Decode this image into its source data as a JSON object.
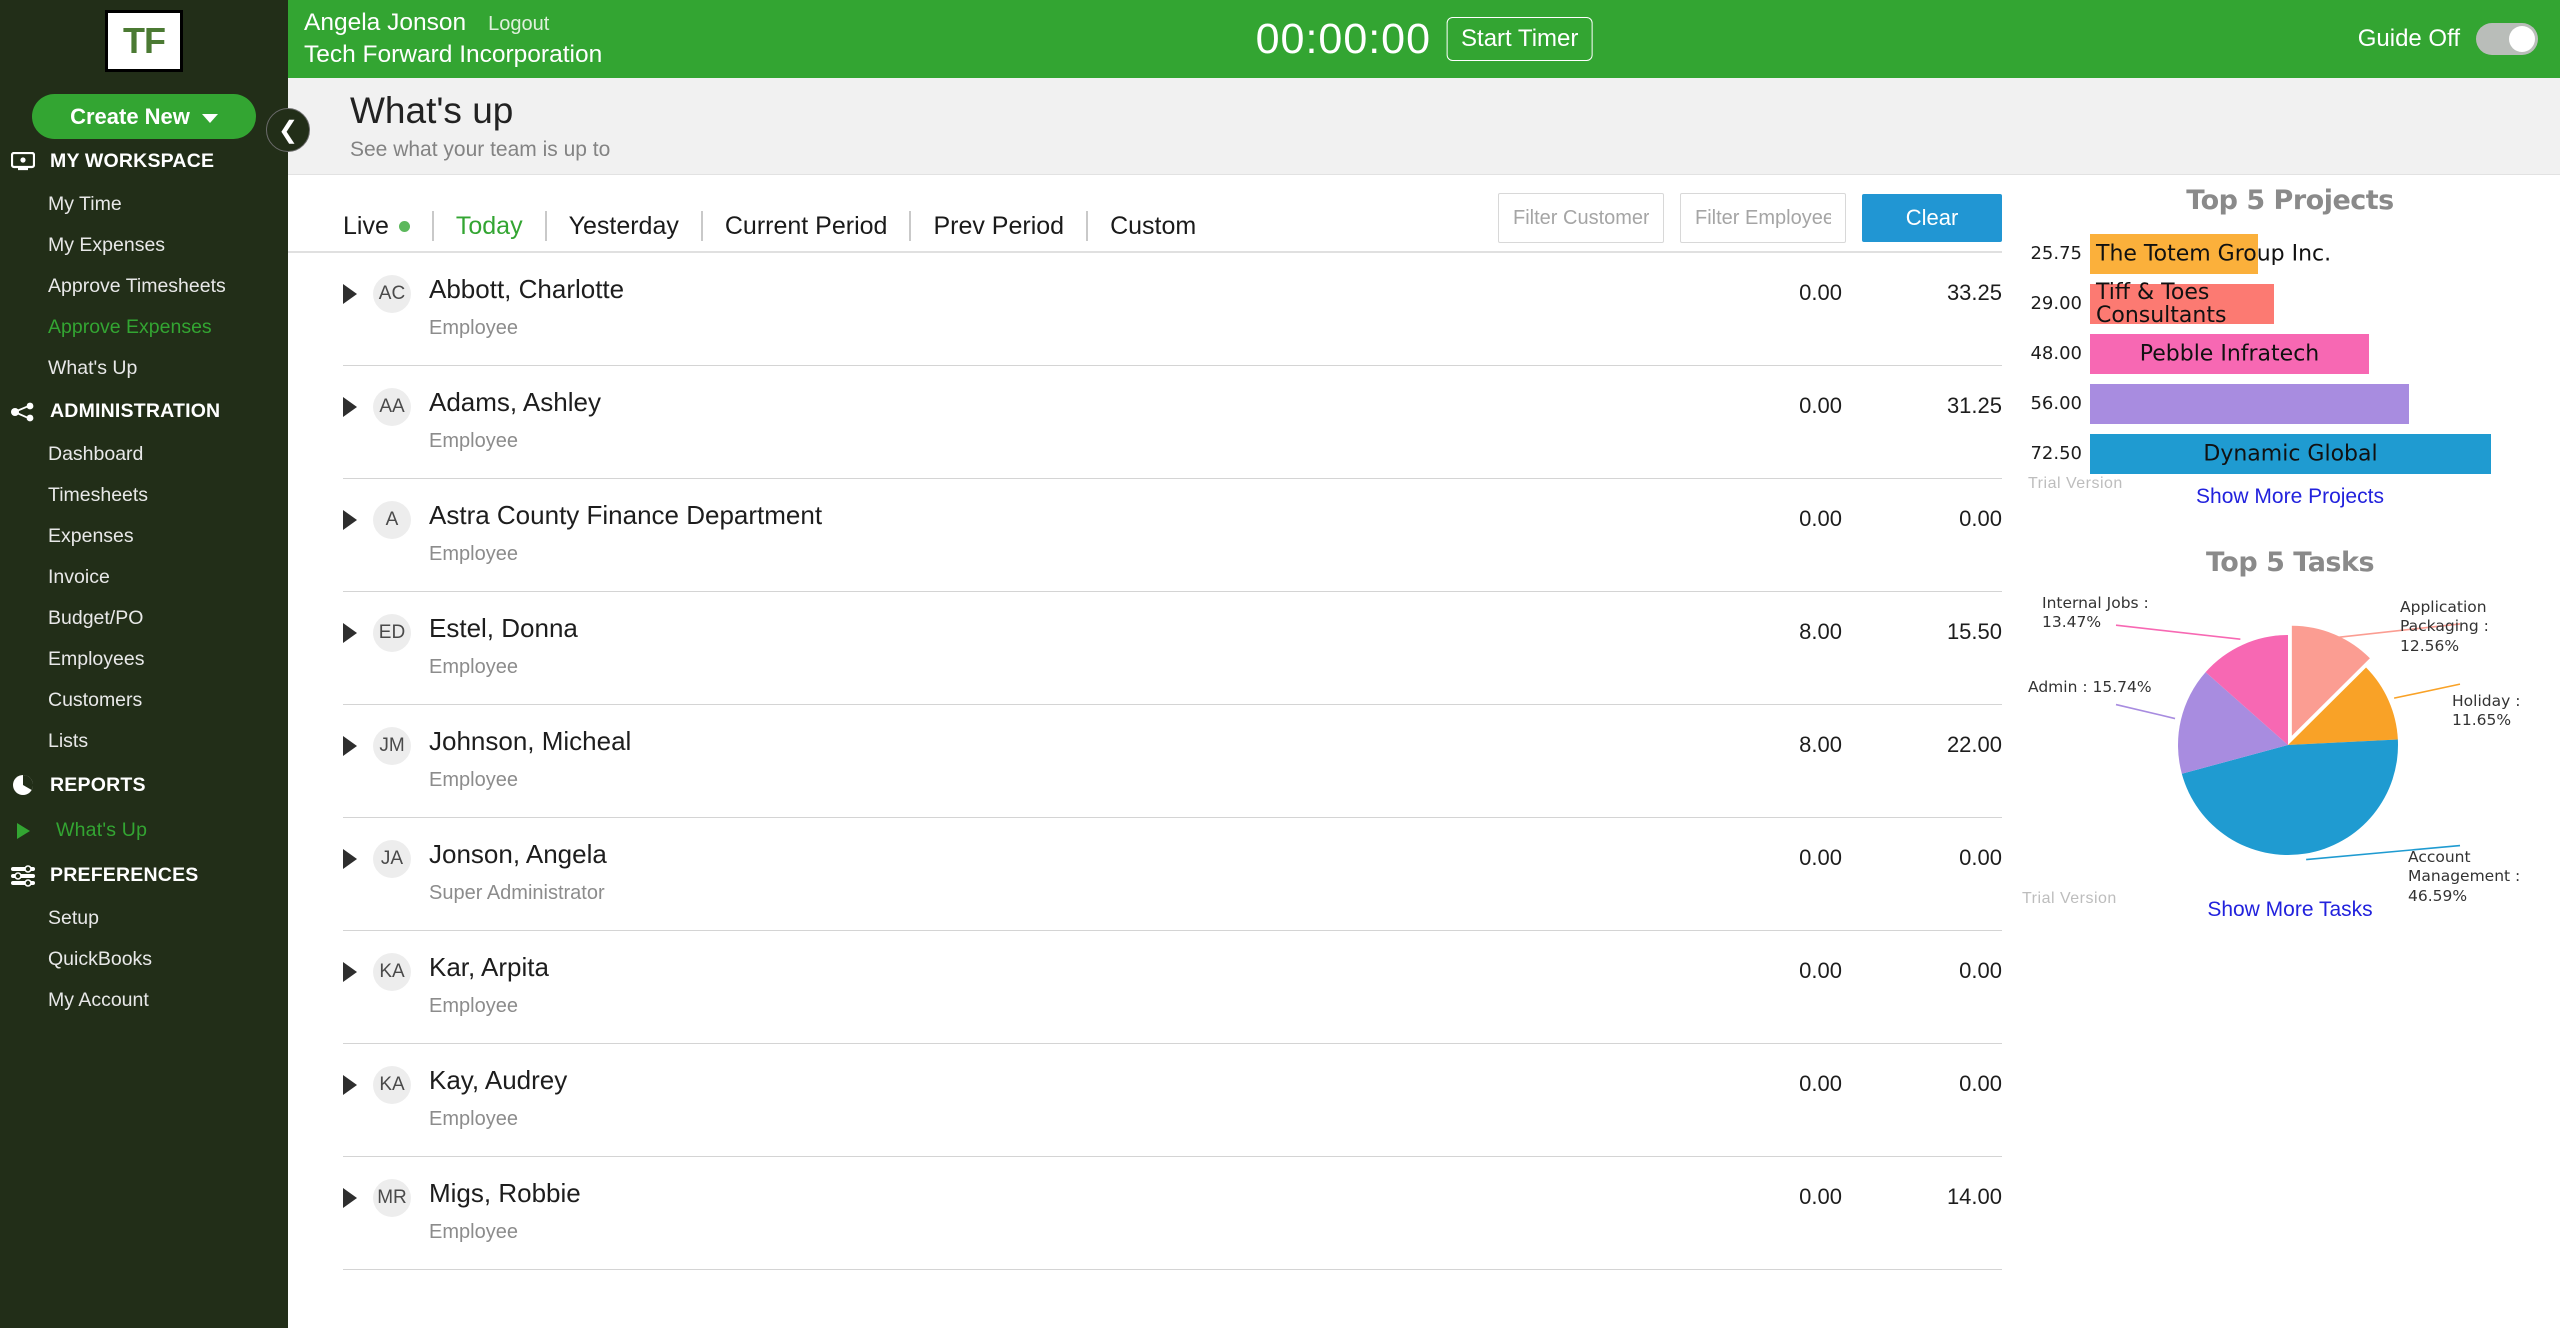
{
  "brand": {
    "logo_text": "TF",
    "create_new_label": "Create New"
  },
  "sidebar": {
    "sections": [
      {
        "title": "MY WORKSPACE",
        "icon": "monitor-icon",
        "items": [
          {
            "label": "My Time",
            "active": false
          },
          {
            "label": "My Expenses",
            "active": false
          },
          {
            "label": "Approve Timesheets",
            "active": false
          },
          {
            "label": "Approve Expenses",
            "active": true
          },
          {
            "label": "What's Up",
            "active": false
          }
        ]
      },
      {
        "title": "ADMINISTRATION",
        "icon": "share-nodes-icon",
        "items": [
          {
            "label": "Dashboard",
            "active": false
          },
          {
            "label": "Timesheets",
            "active": false
          },
          {
            "label": "Expenses",
            "active": false
          },
          {
            "label": "Invoice",
            "active": false
          },
          {
            "label": "Budget/PO",
            "active": false
          },
          {
            "label": "Employees",
            "active": false
          },
          {
            "label": "Customers",
            "active": false
          },
          {
            "label": "Lists",
            "active": false
          }
        ]
      },
      {
        "title": "REPORTS",
        "icon": "pie-chart-icon",
        "items": [
          {
            "label": "What's Up",
            "active": true,
            "bullet": "play-icon"
          }
        ]
      },
      {
        "title": "PREFERENCES",
        "icon": "sliders-icon",
        "items": [
          {
            "label": "Setup",
            "active": false
          },
          {
            "label": "QuickBooks",
            "active": false
          },
          {
            "label": "My Account",
            "active": false
          }
        ]
      }
    ]
  },
  "topbar": {
    "user_name": "Angela Jonson",
    "logout_label": "Logout",
    "company": "Tech Forward Incorporation",
    "timer_value": "00:00:00",
    "start_timer_label": "Start Timer",
    "guide_label": "Guide Off",
    "guide_state": "off"
  },
  "page": {
    "title": "What's up",
    "subtitle": "See what your team is up to",
    "collapse_icon": "chevron-left-icon"
  },
  "tabs": [
    {
      "label": "Live",
      "active": false,
      "dot": true
    },
    {
      "label": "Today",
      "active": true,
      "dot": false
    },
    {
      "label": "Yesterday",
      "active": false,
      "dot": false
    },
    {
      "label": "Current Period",
      "active": false,
      "dot": false
    },
    {
      "label": "Prev Period",
      "active": false,
      "dot": false
    },
    {
      "label": "Custom",
      "active": false,
      "dot": false
    }
  ],
  "filters": {
    "customer_placeholder": "Filter Customer",
    "customer_value": "",
    "employee_placeholder": "Filter Employee",
    "employee_value": "",
    "clear_label": "Clear",
    "clear_color": "#2196d3"
  },
  "employees": [
    {
      "initials": "AC",
      "name": "Abbott, Charlotte",
      "role": "Employee",
      "col1": "0.00",
      "col2": "33.25"
    },
    {
      "initials": "AA",
      "name": "Adams, Ashley",
      "role": "Employee",
      "col1": "0.00",
      "col2": "31.25"
    },
    {
      "initials": "A",
      "name": "Astra County Finance Department",
      "role": "Employee",
      "col1": "0.00",
      "col2": "0.00"
    },
    {
      "initials": "ED",
      "name": "Estel, Donna",
      "role": "Employee",
      "col1": "8.00",
      "col2": "15.50"
    },
    {
      "initials": "JM",
      "name": "Johnson, Micheal",
      "role": "Employee",
      "col1": "8.00",
      "col2": "22.00"
    },
    {
      "initials": "JA",
      "name": "Jonson, Angela",
      "role": "Super Administrator",
      "col1": "0.00",
      "col2": "0.00"
    },
    {
      "initials": "KA",
      "name": "Kar, Arpita",
      "role": "Employee",
      "col1": "0.00",
      "col2": "0.00"
    },
    {
      "initials": "KA",
      "name": "Kay, Audrey",
      "role": "Employee",
      "col1": "0.00",
      "col2": "0.00"
    },
    {
      "initials": "MR",
      "name": "Migs, Robbie",
      "role": "Employee",
      "col1": "0.00",
      "col2": "14.00"
    }
  ],
  "projects_panel": {
    "show_more_label": "Show More Projects",
    "watermark": "Trial Version"
  },
  "tasks_panel": {
    "show_more_label": "Show More Tasks",
    "watermark": "Trial Version"
  },
  "chart_data": [
    {
      "type": "bar",
      "title": "Top 5 Projects",
      "orientation": "horizontal",
      "categories": [
        "The Totem Group Inc.",
        "Tiff & Toes Consultants",
        "Pebble Infratech",
        "",
        "Dynamic Global"
      ],
      "values": [
        25.75,
        29.0,
        48.0,
        56.0,
        72.5
      ],
      "tick_labels": [
        "25.75",
        "29.00",
        "48.00",
        "56.00",
        "72.50"
      ],
      "colors": [
        "#fbb03b",
        "#fc7a72",
        "#f768b3",
        "#a88ce0",
        "#1f9bd1"
      ],
      "xlabel": "",
      "ylabel": "",
      "grid": false,
      "legend": false
    },
    {
      "type": "pie",
      "title": "Top 5 Tasks",
      "labels": [
        "Application Packaging",
        "Holiday",
        "Account Management",
        "Admin",
        "Internal Jobs"
      ],
      "values": [
        12.56,
        11.65,
        46.59,
        15.74,
        13.47
      ],
      "annotations": [
        "Application Packaging : 12.56%",
        "Holiday : 11.65%",
        "Account Management : 46.59%",
        "Admin : 15.74%",
        "Internal Jobs : 13.47%"
      ],
      "colors": [
        "#fb9d92",
        "#f9a227",
        "#1f9bd1",
        "#a88ce0",
        "#f768b3"
      ],
      "unit": "%",
      "legend": false
    }
  ]
}
